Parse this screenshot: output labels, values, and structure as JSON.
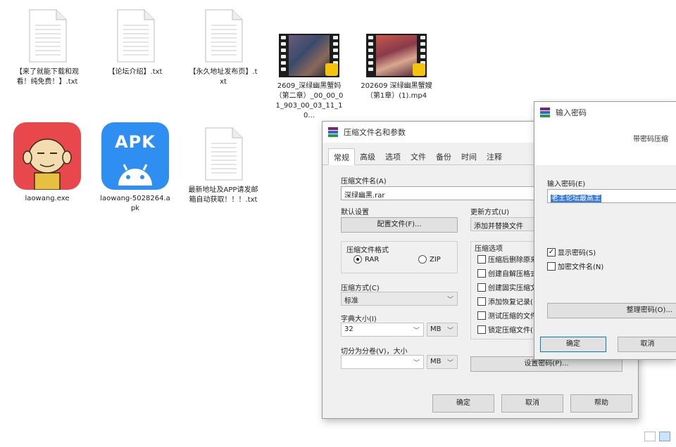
{
  "desktop_files": [
    {
      "kind": "doc",
      "caption": "【来了就能下载和观看！纯免费！】.txt"
    },
    {
      "kind": "doc",
      "caption": "【论坛介绍】.txt"
    },
    {
      "kind": "doc",
      "caption": "【永久地址发布页】.txt"
    },
    {
      "kind": "video",
      "caption": "2609_深绿幽黑蟹妈（第二章）_00_00_01_903_00_03_11_10..."
    },
    {
      "kind": "video",
      "caption": "202609 深绿幽黑蟹嫂（第1章）(1).mp4"
    },
    {
      "kind": "app",
      "caption": "laowang.exe"
    },
    {
      "kind": "apk",
      "caption": "laowang-5028264.apk",
      "icon_text": "APK"
    },
    {
      "kind": "doc",
      "caption": "最新地址及APP请发邮箱自动获取！！！.txt"
    }
  ],
  "archive_dialog": {
    "title": "压缩文件名和参数",
    "tabs": [
      "常规",
      "高级",
      "选项",
      "文件",
      "备份",
      "时间",
      "注释"
    ],
    "archive_name_label": "压缩文件名(A)",
    "archive_name_value": "深绿幽黑.rar",
    "default_settings_label": "默认设置",
    "profiles_button": "配置文件(F)...",
    "update_mode_label": "更新方式(U)",
    "update_mode_value": "添加并替换文件",
    "format_group_label": "压缩文件格式",
    "format_rar": "RAR",
    "format_zip": "ZIP",
    "method_label": "压缩方式(C)",
    "method_value": "标准",
    "dict_label": "字典大小(I)",
    "dict_value": "32",
    "dict_unit": "MB",
    "split_label": "切分为分卷(V)，大小",
    "split_unit": "MB",
    "options_group_label": "压缩选项",
    "options": [
      "压缩后删除原来",
      "创建自解压格式",
      "创建固实压缩文",
      "添加恢复记录(",
      "测试压缩的文件",
      "锁定压缩文件("
    ],
    "set_password_button": "设置密码(P)...",
    "ok": "确定",
    "cancel": "取消",
    "help": "帮助"
  },
  "password_dialog": {
    "title": "输入密码",
    "subtitle": "带密码压缩",
    "input_label": "输入密码(E)",
    "input_value": "老王论坛最高王",
    "show_password": "显示密码(S)",
    "encrypt_names": "加密文件名(N)",
    "organize_button": "整理密码(O)...",
    "ok": "确定",
    "cancel": "取消"
  },
  "colors": {
    "accent": "#0078d7",
    "app_red": "#e8474c",
    "apk_blue": "#2f8ff0",
    "selection": "#3a7bd5"
  }
}
